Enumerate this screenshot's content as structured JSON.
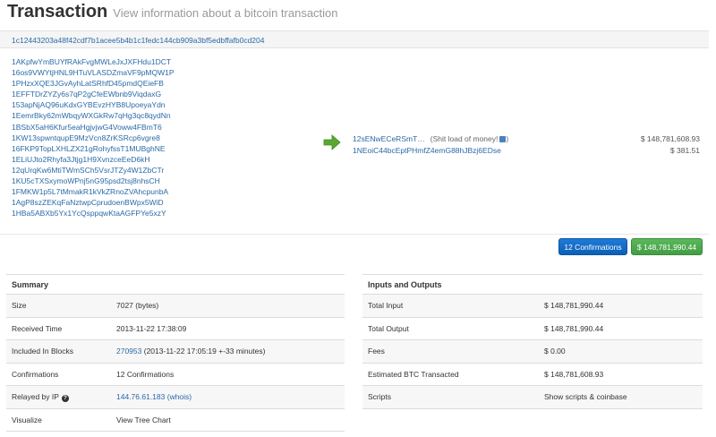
{
  "header": {
    "title": "Transaction",
    "subtitle": "View information about a bitcoin transaction"
  },
  "tx_hash": "1c12443203a48f42cdf7b1acee5b4b1c1fedc144cb909a3bf5edbffafb0cd204",
  "inputs": [
    "1AKpfwYmBUYfRAkFvgMWLeJxJXFHdu1DCT",
    "16os9VWYtjHNL9HTuVLASDZmaVF9pMQW1P",
    "1PHzxXQE3JGvAyhLatSRhfD45pmdQEieFB",
    "1EFFTDrZYZy6s7qP2gCfeEWbnb9ViqdaxG",
    "153apNjAQ96uKdxGYBEvzHYB8UpoeyaYdn",
    "1EemrBky62mWbqyWXGkRw7qHg3qc8qydNn",
    "1BSbX5aH6Kfur5eaHgjvjwG4Voww4FBmT6",
    "1KW13spwntqupE9MzVcn8ZrKSRcp6vgre8",
    "16FKP9TopLXHLZX21gRohyfssT1MUBghNE",
    "1ELiUJto2Rhyfa3Jtjg1H9XvnzceEeD6kH",
    "12qUrqKw6MtiTWmSCh5VsrJTZy4W1ZbCTr",
    "1KU5cTXSxymoWPnj5nG95psd2tsj8nhsCH",
    "1FMKW1p5L7tMmakR1kVkZRnoZVAhcpunbA",
    "1AgP8szZEKqFaNztwpCprudoenBWpx5WiD",
    "1HBa5ABXb5Yx1YcQsppqwKtaAGFPYe5xzY"
  ],
  "outputs": [
    {
      "address": "12sENwECeRSmT…",
      "note": "(Shit load of money!",
      "amount": "$ 148,781,608.93"
    },
    {
      "address": "1NEoiC44bcEptPHmfZ4emG88hJBzj6EDse",
      "note": "",
      "amount": "$ 381.51"
    }
  ],
  "buttons": {
    "confirmations": "12 Confirmations",
    "total": "$ 148,781,990.44"
  },
  "summary": {
    "title": "Summary",
    "size_label": "Size",
    "size_value": "7027 (bytes)",
    "received_label": "Received Time",
    "received_value": "2013-11-22 17:38:09",
    "included_label": "Included In Blocks",
    "included_block": "270953",
    "included_detail": "(2013-11-22 17:05:19 +-33 minutes)",
    "confirmations_label": "Confirmations",
    "confirmations_value": "12 Confirmations",
    "relayed_label": "Relayed by IP",
    "relayed_icon": "?",
    "relayed_ip": "144.76.61.183",
    "relayed_whois": "(whois)",
    "visualize_label": "Visualize",
    "visualize_link": "View Tree Chart"
  },
  "io": {
    "title": "Inputs and Outputs",
    "total_input_label": "Total Input",
    "total_input_value": "$ 148,781,990.44",
    "total_output_label": "Total Output",
    "total_output_value": "$ 148,781,990.44",
    "fees_label": "Fees",
    "fees_value": "$ 0.00",
    "estimated_label": "Estimated BTC Transacted",
    "estimated_value": "$ 148,781,608.93",
    "scripts_label": "Scripts",
    "scripts_link": "Show scripts & coinbase"
  },
  "colors": {
    "link": "#2a6aa8",
    "confirm_button": "#1f7ad8",
    "total_button": "#5bb85b",
    "arrow": "#5aa832"
  }
}
